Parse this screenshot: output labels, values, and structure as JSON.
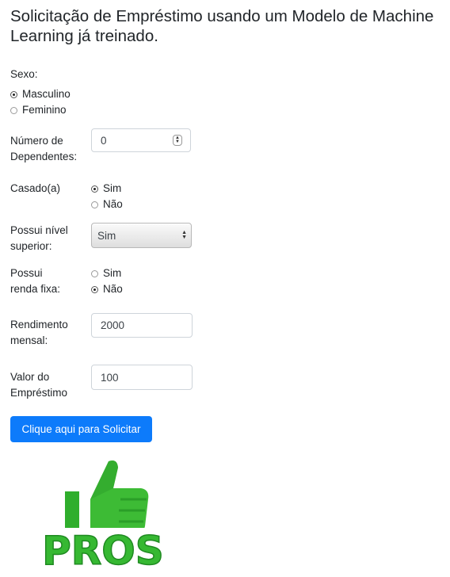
{
  "title": "Solicitação de Empréstimo usando um Modelo de Machine Learning já treinado.",
  "sexo": {
    "label": "Sexo:",
    "options": [
      {
        "label": "Masculino",
        "checked": true
      },
      {
        "label": "Feminino",
        "checked": false
      }
    ]
  },
  "dependentes": {
    "label_line1": "Número de",
    "label_line2": "Dependentes:",
    "value": "0"
  },
  "casado": {
    "label": "Casado(a)",
    "options": [
      {
        "label": "Sim",
        "checked": true
      },
      {
        "label": "Não",
        "checked": false
      }
    ]
  },
  "superior": {
    "label_line1": "Possui nível",
    "label_line2": "superior:",
    "selected": "Sim"
  },
  "renda_fixa": {
    "label_line1": "Possui",
    "label_line2": "renda fixa:",
    "options": [
      {
        "label": "Sim",
        "checked": false
      },
      {
        "label": "Não",
        "checked": true
      }
    ]
  },
  "rendimento": {
    "label_line1": "Rendimento",
    "label_line2": "mensal:",
    "value": "2000"
  },
  "valor": {
    "label_line1": "Valor do",
    "label_line2": "Empréstimo",
    "value": "100"
  },
  "submit_label": "Clique aqui para Solicitar",
  "logo": {
    "text": "PROS",
    "icon": "thumbs-up-icon",
    "colors": {
      "green": "#33b52f",
      "dark_green": "#1f8a21"
    }
  }
}
